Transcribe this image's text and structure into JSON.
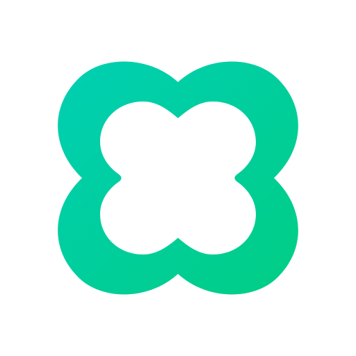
{
  "icon": {
    "name": "clover-cross-logo-icon",
    "shape": "four-lobed rounded cross outline",
    "gradient_start": "#00CFB4",
    "gradient_end": "#00CE84",
    "background": "#FFFFFF"
  }
}
